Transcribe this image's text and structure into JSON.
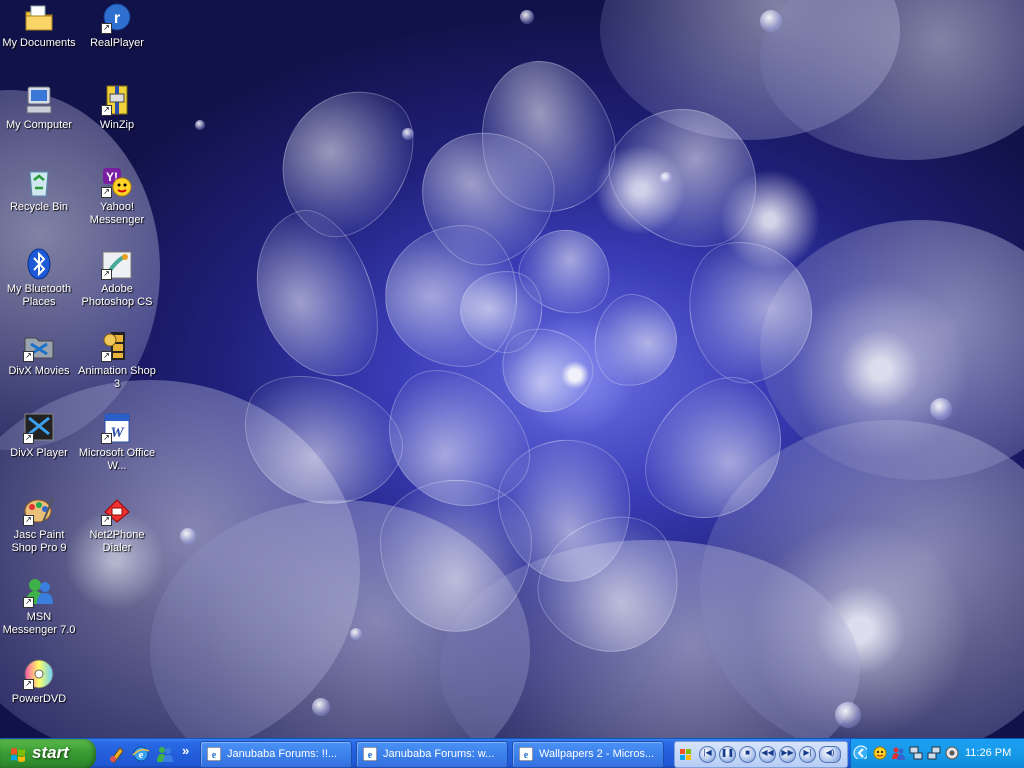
{
  "desktop_icons": [
    {
      "label": "My Documents",
      "icon": "my-documents-icon"
    },
    {
      "label": "My Computer",
      "icon": "my-computer-icon"
    },
    {
      "label": "Recycle Bin",
      "icon": "recycle-bin-icon"
    },
    {
      "label": "My Bluetooth Places",
      "icon": "bluetooth-icon"
    },
    {
      "label": "DivX Movies",
      "icon": "divx-movies-icon"
    },
    {
      "label": "DivX Player",
      "icon": "divx-player-icon"
    },
    {
      "label": "Jasc Paint Shop Pro 9",
      "icon": "paint-shop-pro-icon"
    },
    {
      "label": "MSN Messenger 7.0",
      "icon": "msn-messenger-icon"
    },
    {
      "label": "PowerDVD",
      "icon": "powerdvd-icon"
    },
    {
      "label": "RealPlayer",
      "icon": "realplayer-icon"
    },
    {
      "label": "WinZip",
      "icon": "winzip-icon"
    },
    {
      "label": "Yahoo! Messenger",
      "icon": "yahoo-messenger-icon"
    },
    {
      "label": "Adobe Photoshop CS",
      "icon": "photoshop-icon"
    },
    {
      "label": "Animation Shop 3",
      "icon": "animation-shop-icon"
    },
    {
      "label": "Microsoft Office W...",
      "icon": "word-icon"
    },
    {
      "label": "Net2Phone Dialer",
      "icon": "net2phone-icon"
    }
  ],
  "taskbar": {
    "start_label": "start",
    "quick_launch": [
      "media-icon",
      "internet-explorer-icon",
      "messenger-icon"
    ],
    "overflow_chevron": "»",
    "tasks": [
      {
        "label": "Janubaba Forums: !!...",
        "icon": "internet-explorer-icon"
      },
      {
        "label": "Janubaba Forums: w...",
        "icon": "internet-explorer-icon"
      },
      {
        "label": "Wallpapers 2 - Micros...",
        "icon": "internet-explorer-icon"
      }
    ],
    "media_player_controls": [
      "previous",
      "pause",
      "stop",
      "rewind",
      "fast-forward",
      "volume"
    ],
    "tray_icons": [
      "collapse-arrow-icon",
      "yahoo-tray-icon",
      "users-tray-icon",
      "network-tray-icon",
      "network-tray-icon-2",
      "speaker-tray-icon"
    ],
    "clock": "11:26 PM"
  },
  "colors": {
    "taskbar_blue": "#245edb",
    "start_green": "#3c9f36",
    "tray_blue": "#169ae8",
    "wallpaper_dark": "#20207a"
  }
}
